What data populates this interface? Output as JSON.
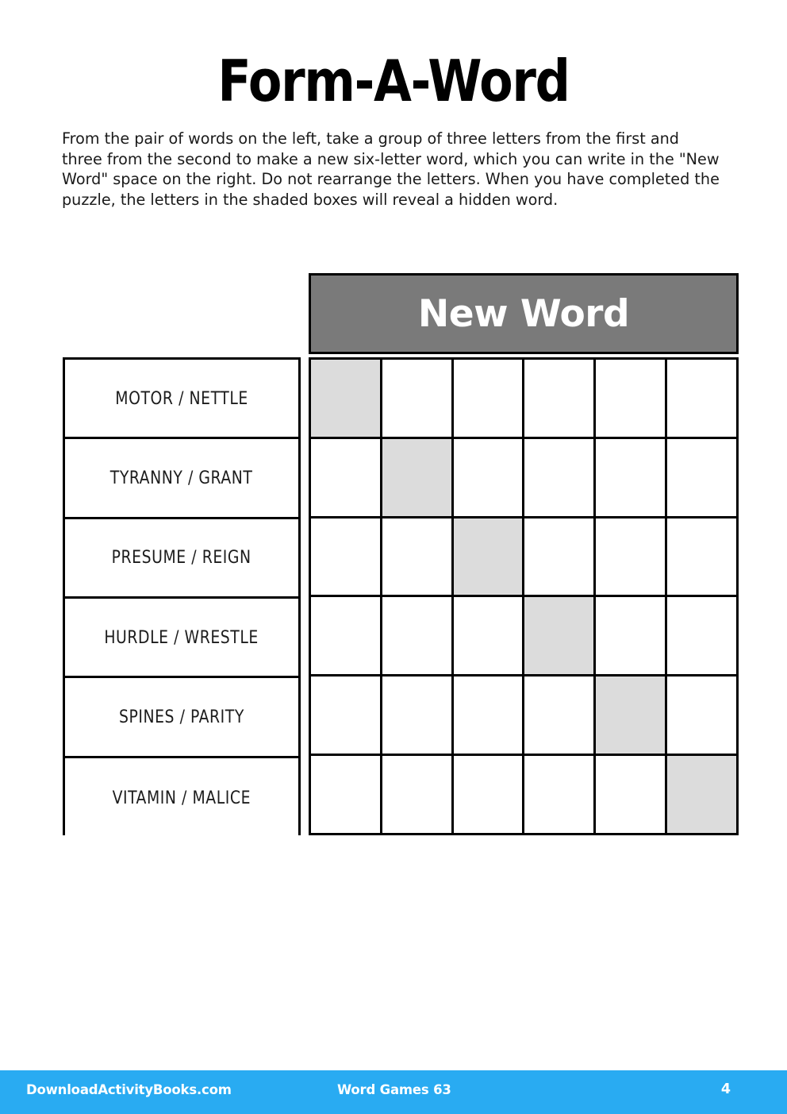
{
  "page": {
    "title": "Form-A-Word",
    "instructions": "From the pair of words on the left, take a group of three letters from the first and three from the second to make a new six-letter word, which you can write in the \"New Word\" space on the right. Do not rearrange the letters. When you have completed the puzzle, the letters in the shaded boxes will reveal a hidden word."
  },
  "puzzle": {
    "answer_header": "New Word",
    "columns": 6,
    "header_bg": "#7a7a7a",
    "shaded_bg": "#dcdcdc",
    "rows": [
      {
        "pair": "MOTOR / NETTLE",
        "shaded_index": 0,
        "cells": [
          "",
          "",
          "",
          "",
          "",
          ""
        ]
      },
      {
        "pair": "TYRANNY / GRANT",
        "shaded_index": 1,
        "cells": [
          "",
          "",
          "",
          "",
          "",
          ""
        ]
      },
      {
        "pair": "PRESUME / REIGN",
        "shaded_index": 2,
        "cells": [
          "",
          "",
          "",
          "",
          "",
          ""
        ]
      },
      {
        "pair": "HURDLE / WRESTLE",
        "shaded_index": 3,
        "cells": [
          "",
          "",
          "",
          "",
          "",
          ""
        ]
      },
      {
        "pair": "SPINES / PARITY",
        "shaded_index": 4,
        "cells": [
          "",
          "",
          "",
          "",
          "",
          ""
        ]
      },
      {
        "pair": "VITAMIN / MALICE",
        "shaded_index": 5,
        "cells": [
          "",
          "",
          "",
          "",
          "",
          ""
        ]
      }
    ]
  },
  "footer": {
    "site": "DownloadActivityBooks.com",
    "book": "Word Games 63",
    "page_number": "4",
    "bg_color": "#29abf2"
  }
}
